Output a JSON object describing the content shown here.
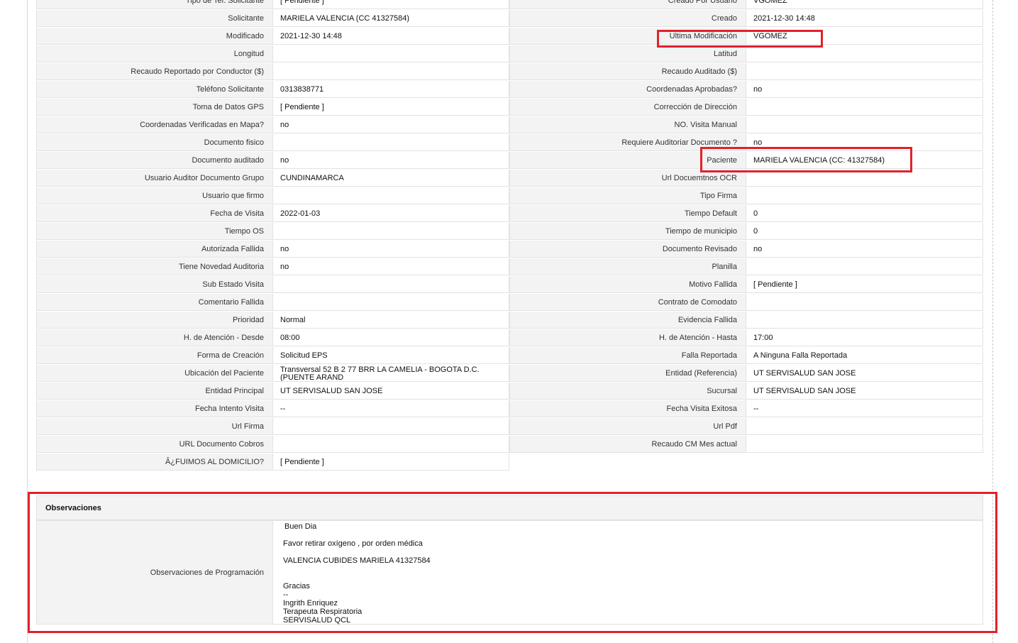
{
  "rows": [
    {
      "l1": "Tipo de Tel. Solicitante",
      "v1": "[ Pendiente ]",
      "l2": "Creado Por Usuario",
      "v2": "VGOMEZ"
    },
    {
      "l1": "Solicitante",
      "v1": "MARIELA VALENCIA (CC 41327584)",
      "l2": "Creado",
      "v2": "2021-12-30 14:48"
    },
    {
      "l1": "Modificado",
      "v1": "2021-12-30 14:48",
      "l2": "Ultima Modificación",
      "v2": " VGOMEZ"
    },
    {
      "l1": "Longitud",
      "v1": "",
      "l2": "Latitud",
      "v2": ""
    },
    {
      "l1": "Recaudo Reportado por Conductor ($)",
      "v1": "",
      "l2": "Recaudo Auditado ($)",
      "v2": ""
    },
    {
      "l1": "Teléfono Solicitante",
      "v1": "0313838771",
      "l2": "Coordenadas Aprobadas?",
      "v2": " no"
    },
    {
      "l1": "Toma de Datos GPS",
      "v1": "[ Pendiente ]",
      "l2": "Corrección de Dirección",
      "v2": ""
    },
    {
      "l1": "Coordenadas Verificadas en Mapa?",
      "v1": " no",
      "l2": "NO. Visita Manual",
      "v2": ""
    },
    {
      "l1": "Documento fisico",
      "v1": "",
      "l2": "Requiere Auditoriar Documento ?",
      "v2": " no"
    },
    {
      "l1": "Documento auditado",
      "v1": " no",
      "l2": "Paciente",
      "v2": "MARIELA VALENCIA (CC: 41327584)"
    },
    {
      "l1": "Usuario Auditor Documento Grupo",
      "v1": "CUNDINAMARCA",
      "l2": "Url Docuemtnos OCR",
      "v2": ""
    },
    {
      "l1": "Usuario que firmo",
      "v1": "",
      "l2": "Tipo Firma",
      "v2": ""
    },
    {
      "l1": "Fecha de Visita",
      "v1": " 2022-01-03",
      "l2": "Tiempo Default",
      "v2": "0"
    },
    {
      "l1": "Tiempo OS",
      "v1": "",
      "l2": "Tiempo de municipio",
      "v2": "0"
    },
    {
      "l1": "Autorizada Fallida",
      "v1": " no",
      "l2": "Documento Revisado",
      "v2": " no"
    },
    {
      "l1": "Tiene Novedad Auditoria",
      "v1": " no",
      "l2": "Planilla",
      "v2": ""
    },
    {
      "l1": "Sub Estado Visita",
      "v1": "",
      "l2": "Motivo Fallida",
      "v2": "[ Pendiente ]"
    },
    {
      "l1": "Comentario Fallida",
      "v1": "",
      "l2": "Contrato de Comodato",
      "v2": ""
    },
    {
      "l1": "Prioridad",
      "v1": "Normal",
      "l2": "Evidencia Fallida",
      "v2": ""
    },
    {
      "l1": "H. de Atención - Desde",
      "v1": "08:00",
      "l2": "H. de Atención - Hasta",
      "v2": "17:00"
    },
    {
      "l1": "Forma de Creación",
      "v1": "Solicitud EPS",
      "l2": "Falla Reportada",
      "v2": "A Ninguna Falla Reportada"
    },
    {
      "l1": "Ubicación del Paciente",
      "v1": "Transversal 52 B 2 77 BRR LA CAMELIA - BOGOTA D.C. (PUENTE ARAND",
      "l2": "Entidad (Referencia)",
      "v2": "UT SERVISALUD SAN JOSE"
    },
    {
      "l1": "Entidad Principal",
      "v1": "UT SERVISALUD SAN JOSE",
      "l2": "Sucursal",
      "v2": "UT SERVISALUD SAN JOSE"
    },
    {
      "l1": "Fecha Intento Visita",
      "v1": " --",
      "l2": "Fecha Visita Exitosa",
      "v2": " --"
    },
    {
      "l1": "Url Firma",
      "v1": "",
      "l2": "Url Pdf",
      "v2": ""
    },
    {
      "l1": "URL Documento Cobros",
      "v1": "",
      "l2": "Recaudo CM Mes actual",
      "v2": ""
    },
    {
      "l1": "Â¿FUIMOS AL DOMICILIO?",
      "v1": "[ Pendiente ]",
      "l2": null,
      "v2": null
    }
  ],
  "observaciones": {
    "header": "Observaciones",
    "label": "Observaciones de Programación",
    "lines": [
      "Buen Dia",
      "Favor retirar oxígeno , por orden médica",
      "VALENCIA CUBIDES MARIELA 41327584",
      "Gracias",
      "--",
      "Ingrith Enriquez",
      "Terapeuta Respiratoria",
      "SERVISALUD QCL"
    ]
  },
  "colors": {
    "highlight": "#e3202b",
    "label_bg": "#f3f3f3",
    "border": "#e2e2e2"
  }
}
